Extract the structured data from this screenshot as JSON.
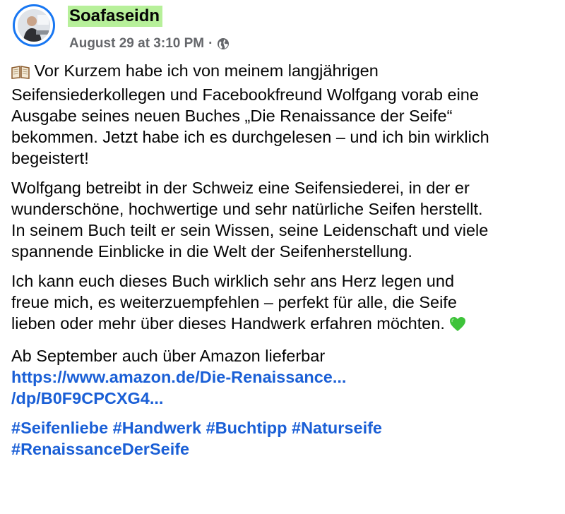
{
  "post": {
    "author": "Soafaseidn",
    "date": "August 29 at 3:10 PM",
    "separator": "·",
    "audience_icon": "globe-icon",
    "paragraphs": [
      {
        "lines": [
          "Vor Kurzem habe ich von meinem langjährigen",
          "Seifensiederkollegen und Facebookfreund Wolfgang vorab eine",
          "Ausgabe seines neuen Buches „Die Renaissance der Seife“",
          "bekommen. Jetzt habe ich es durchgelesen – und ich bin wirklich",
          "begeistert!"
        ],
        "leading_emoji": "book-emoji"
      },
      {
        "lines": [
          "Wolfgang betreibt in der Schweiz eine Seifensiederei, in der er",
          "wunderschöne, hochwertige und sehr natürliche Seifen herstellt.",
          "In seinem Buch teilt er sein Wissen, seine Leidenschaft und viele",
          "spannende Einblicke in die Welt der Seifenherstellung."
        ]
      },
      {
        "lines": [
          "Ich kann euch dieses Buch wirklich sehr ans Herz legen und",
          "freue mich, es weiterzuempfehlen – perfekt für alle, die Seife",
          "lieben oder mehr über dieses Handwerk erfahren möchten."
        ],
        "trailing_emoji": "green-heart-emoji"
      },
      {
        "lines": [
          "Ab September auch über Amazon lieferbar"
        ],
        "link_lines": [
          "https://www.amazon.de/Die-Renaissance...",
          "/dp/B0F9CPCXG4..."
        ]
      }
    ],
    "hashtags_line1": "#Seifenliebe #Handwerk #Buchtipp #Naturseife",
    "hashtags_line2": "#RenaissanceDerSeife",
    "colors": {
      "link": "#1a5fd6",
      "name_highlight": "#b7f09a",
      "avatar_ring": "#1877f2",
      "meta": "#65676b",
      "heart": "#3ec33a"
    }
  }
}
